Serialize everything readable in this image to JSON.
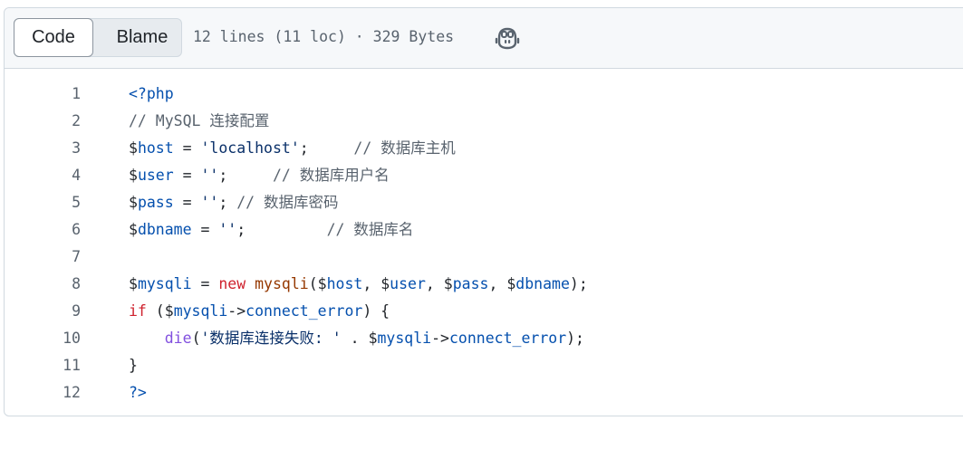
{
  "header": {
    "code_label": "Code",
    "blame_label": "Blame",
    "file_info": "12 lines (11 loc) · 329 Bytes",
    "copilot_icon": "copilot-icon"
  },
  "colors": {
    "keyword": "#cf222e",
    "variable": "#0550ae",
    "string": "#0a3069",
    "comment": "#59636e",
    "function": "#8250df",
    "class": "#953800"
  },
  "code_lines": [
    {
      "num": "1",
      "tokens": [
        {
          "t": "<?php",
          "c": "tag"
        }
      ]
    },
    {
      "num": "2",
      "tokens": [
        {
          "t": "// MySQL 连接配置",
          "c": "cmt"
        }
      ]
    },
    {
      "num": "3",
      "tokens": [
        {
          "t": "$",
          "c": "plain"
        },
        {
          "t": "host",
          "c": "var"
        },
        {
          "t": " = ",
          "c": "plain"
        },
        {
          "t": "'localhost'",
          "c": "str"
        },
        {
          "t": ";     ",
          "c": "plain"
        },
        {
          "t": "// 数据库主机",
          "c": "cmt"
        }
      ]
    },
    {
      "num": "4",
      "tokens": [
        {
          "t": "$",
          "c": "plain"
        },
        {
          "t": "user",
          "c": "var"
        },
        {
          "t": " = ",
          "c": "plain"
        },
        {
          "t": "''",
          "c": "str"
        },
        {
          "t": ";     ",
          "c": "plain"
        },
        {
          "t": "// 数据库用户名",
          "c": "cmt"
        }
      ]
    },
    {
      "num": "5",
      "tokens": [
        {
          "t": "$",
          "c": "plain"
        },
        {
          "t": "pass",
          "c": "var"
        },
        {
          "t": " = ",
          "c": "plain"
        },
        {
          "t": "''",
          "c": "str"
        },
        {
          "t": "; ",
          "c": "plain"
        },
        {
          "t": "// 数据库密码",
          "c": "cmt"
        }
      ]
    },
    {
      "num": "6",
      "tokens": [
        {
          "t": "$",
          "c": "plain"
        },
        {
          "t": "dbname",
          "c": "var"
        },
        {
          "t": " = ",
          "c": "plain"
        },
        {
          "t": "''",
          "c": "str"
        },
        {
          "t": ";         ",
          "c": "plain"
        },
        {
          "t": "// 数据库名",
          "c": "cmt"
        }
      ]
    },
    {
      "num": "7",
      "tokens": []
    },
    {
      "num": "8",
      "tokens": [
        {
          "t": "$",
          "c": "plain"
        },
        {
          "t": "mysqli",
          "c": "var"
        },
        {
          "t": " = ",
          "c": "plain"
        },
        {
          "t": "new",
          "c": "kw"
        },
        {
          "t": " ",
          "c": "plain"
        },
        {
          "t": "mysqli",
          "c": "cls"
        },
        {
          "t": "(",
          "c": "plain"
        },
        {
          "t": "$",
          "c": "plain"
        },
        {
          "t": "host",
          "c": "var"
        },
        {
          "t": ", ",
          "c": "plain"
        },
        {
          "t": "$",
          "c": "plain"
        },
        {
          "t": "user",
          "c": "var"
        },
        {
          "t": ", ",
          "c": "plain"
        },
        {
          "t": "$",
          "c": "plain"
        },
        {
          "t": "pass",
          "c": "var"
        },
        {
          "t": ", ",
          "c": "plain"
        },
        {
          "t": "$",
          "c": "plain"
        },
        {
          "t": "dbname",
          "c": "var"
        },
        {
          "t": ");",
          "c": "plain"
        }
      ]
    },
    {
      "num": "9",
      "tokens": [
        {
          "t": "if",
          "c": "kw"
        },
        {
          "t": " (",
          "c": "plain"
        },
        {
          "t": "$",
          "c": "plain"
        },
        {
          "t": "mysqli",
          "c": "var"
        },
        {
          "t": "->",
          "c": "plain"
        },
        {
          "t": "connect_error",
          "c": "prop"
        },
        {
          "t": ") {",
          "c": "plain"
        }
      ]
    },
    {
      "num": "10",
      "tokens": [
        {
          "t": "    ",
          "c": "plain"
        },
        {
          "t": "die",
          "c": "fn"
        },
        {
          "t": "(",
          "c": "plain"
        },
        {
          "t": "'数据库连接失败: '",
          "c": "str"
        },
        {
          "t": " . ",
          "c": "plain"
        },
        {
          "t": "$",
          "c": "plain"
        },
        {
          "t": "mysqli",
          "c": "var"
        },
        {
          "t": "->",
          "c": "plain"
        },
        {
          "t": "connect_error",
          "c": "prop"
        },
        {
          "t": ");",
          "c": "plain"
        }
      ]
    },
    {
      "num": "11",
      "tokens": [
        {
          "t": "}",
          "c": "plain"
        }
      ]
    },
    {
      "num": "12",
      "tokens": [
        {
          "t": "?>",
          "c": "tag"
        }
      ]
    }
  ]
}
